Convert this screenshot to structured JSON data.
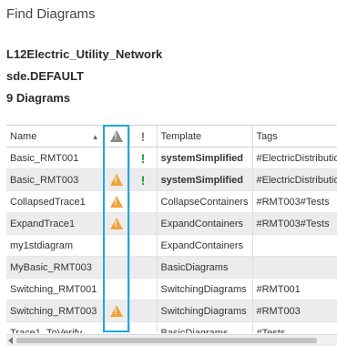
{
  "pane": {
    "title": "Find Diagrams"
  },
  "info": {
    "network": "L12Electric_Utility_Network",
    "version": "sde.DEFAULT",
    "count": "9 Diagrams"
  },
  "columns": {
    "name": "Name",
    "template": "Template",
    "tags": "Tags"
  },
  "rows": [
    {
      "name": "Basic_RMT001",
      "warning": false,
      "status": "!",
      "template": "systemSimplified",
      "template_bold": true,
      "tags": "#ElectricDistribution"
    },
    {
      "name": "Basic_RMT003",
      "warning": true,
      "status": "!",
      "template": "systemSimplified",
      "template_bold": true,
      "tags": "#ElectricDistribution"
    },
    {
      "name": "CollapsedTrace1",
      "warning": true,
      "status": "",
      "template": "CollapseContainers",
      "template_bold": false,
      "tags": "#RMT003#Tests"
    },
    {
      "name": "ExpandTrace1",
      "warning": true,
      "status": "",
      "template": "ExpandContainers",
      "template_bold": false,
      "tags": "#RMT003#Tests"
    },
    {
      "name": "my1stdiagram",
      "warning": false,
      "status": "",
      "template": "ExpandContainers",
      "template_bold": false,
      "tags": ""
    },
    {
      "name": "MyBasic_RMT003",
      "warning": false,
      "status": "",
      "template": "BasicDiagrams",
      "template_bold": false,
      "tags": ""
    },
    {
      "name": "Switching_RMT001",
      "warning": false,
      "status": "",
      "template": "SwitchingDiagrams",
      "template_bold": false,
      "tags": "#RMT001"
    },
    {
      "name": "Switching_RMT003",
      "warning": true,
      "status": "",
      "template": "SwitchingDiagrams",
      "template_bold": false,
      "tags": "#RMT003"
    },
    {
      "name": "Trace1_ToVerify",
      "warning": false,
      "status": "",
      "template": "BasicDiagrams",
      "template_bold": false,
      "tags": "#Tests"
    }
  ],
  "colors": {
    "warning": "#f0a23a",
    "status_green": "#1f9a2e",
    "highlight": "#1fa7e0"
  }
}
